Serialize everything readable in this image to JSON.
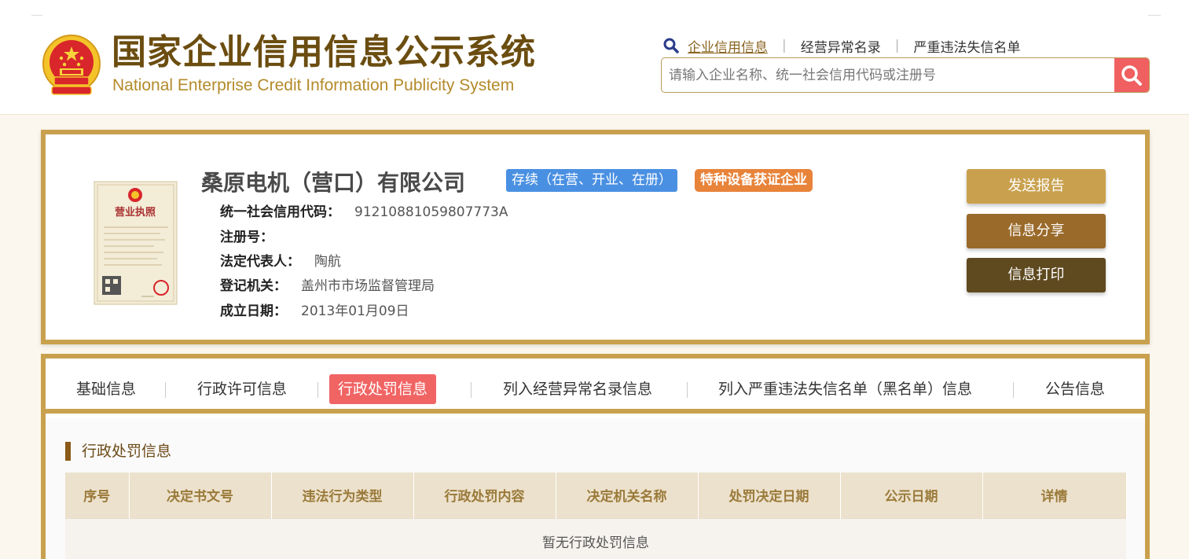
{
  "header": {
    "title_cn": "国家企业信用信息公示系统",
    "title_en": "National Enterprise Credit Information Publicity System",
    "nav": [
      {
        "label": "企业信用信息",
        "active": true
      },
      {
        "label": "经营异常名录",
        "active": false
      },
      {
        "label": "严重违法失信名单",
        "active": false
      }
    ],
    "search_placeholder": "请输入企业名称、统一社会信用代码或注册号",
    "search_value": ""
  },
  "company": {
    "name": "桑原电机（营口）有限公司",
    "status_badge": "存续（在营、开业、在册）",
    "special_badge": "特种设备获证企业",
    "license_title": "营业执照",
    "fields": [
      {
        "label": "统一社会信用代码：",
        "value": "91210881059807773A"
      },
      {
        "label": "注册号：",
        "value": ""
      },
      {
        "label": "法定代表人：",
        "value": "陶航"
      },
      {
        "label": "登记机关：",
        "value": "盖州市市场监督管理局"
      },
      {
        "label": "成立日期：",
        "value": "2013年01月09日"
      }
    ],
    "actions": {
      "send_report": "发送报告",
      "share": "信息分享",
      "print": "信息打印"
    }
  },
  "tabs": [
    {
      "label": "基础信息",
      "active": false
    },
    {
      "label": "行政许可信息",
      "active": false
    },
    {
      "label": "行政处罚信息",
      "active": true
    },
    {
      "label": "列入经营异常名录信息",
      "active": false
    },
    {
      "label": "列入严重违法失信名单（黑名单）信息",
      "active": false
    },
    {
      "label": "公告信息",
      "active": false
    }
  ],
  "section": {
    "title": "行政处罚信息",
    "columns": [
      "序号",
      "决定书文号",
      "违法行为类型",
      "行政处罚内容",
      "决定机关名称",
      "处罚决定日期",
      "公示日期",
      "详情"
    ],
    "empty_text": "暂无行政处罚信息"
  },
  "colors": {
    "gold": "#c9a14e",
    "brown_title": "#6b4d10",
    "tab_active": "#f16464",
    "search_button": "#f06060",
    "status_badge": "#4a90e2",
    "special_badge": "#e8833a"
  },
  "icons": {
    "emblem": "national-emblem-icon",
    "nav_search": "magnifier-icon",
    "search_button": "search-icon",
    "license": "business-license-image"
  }
}
